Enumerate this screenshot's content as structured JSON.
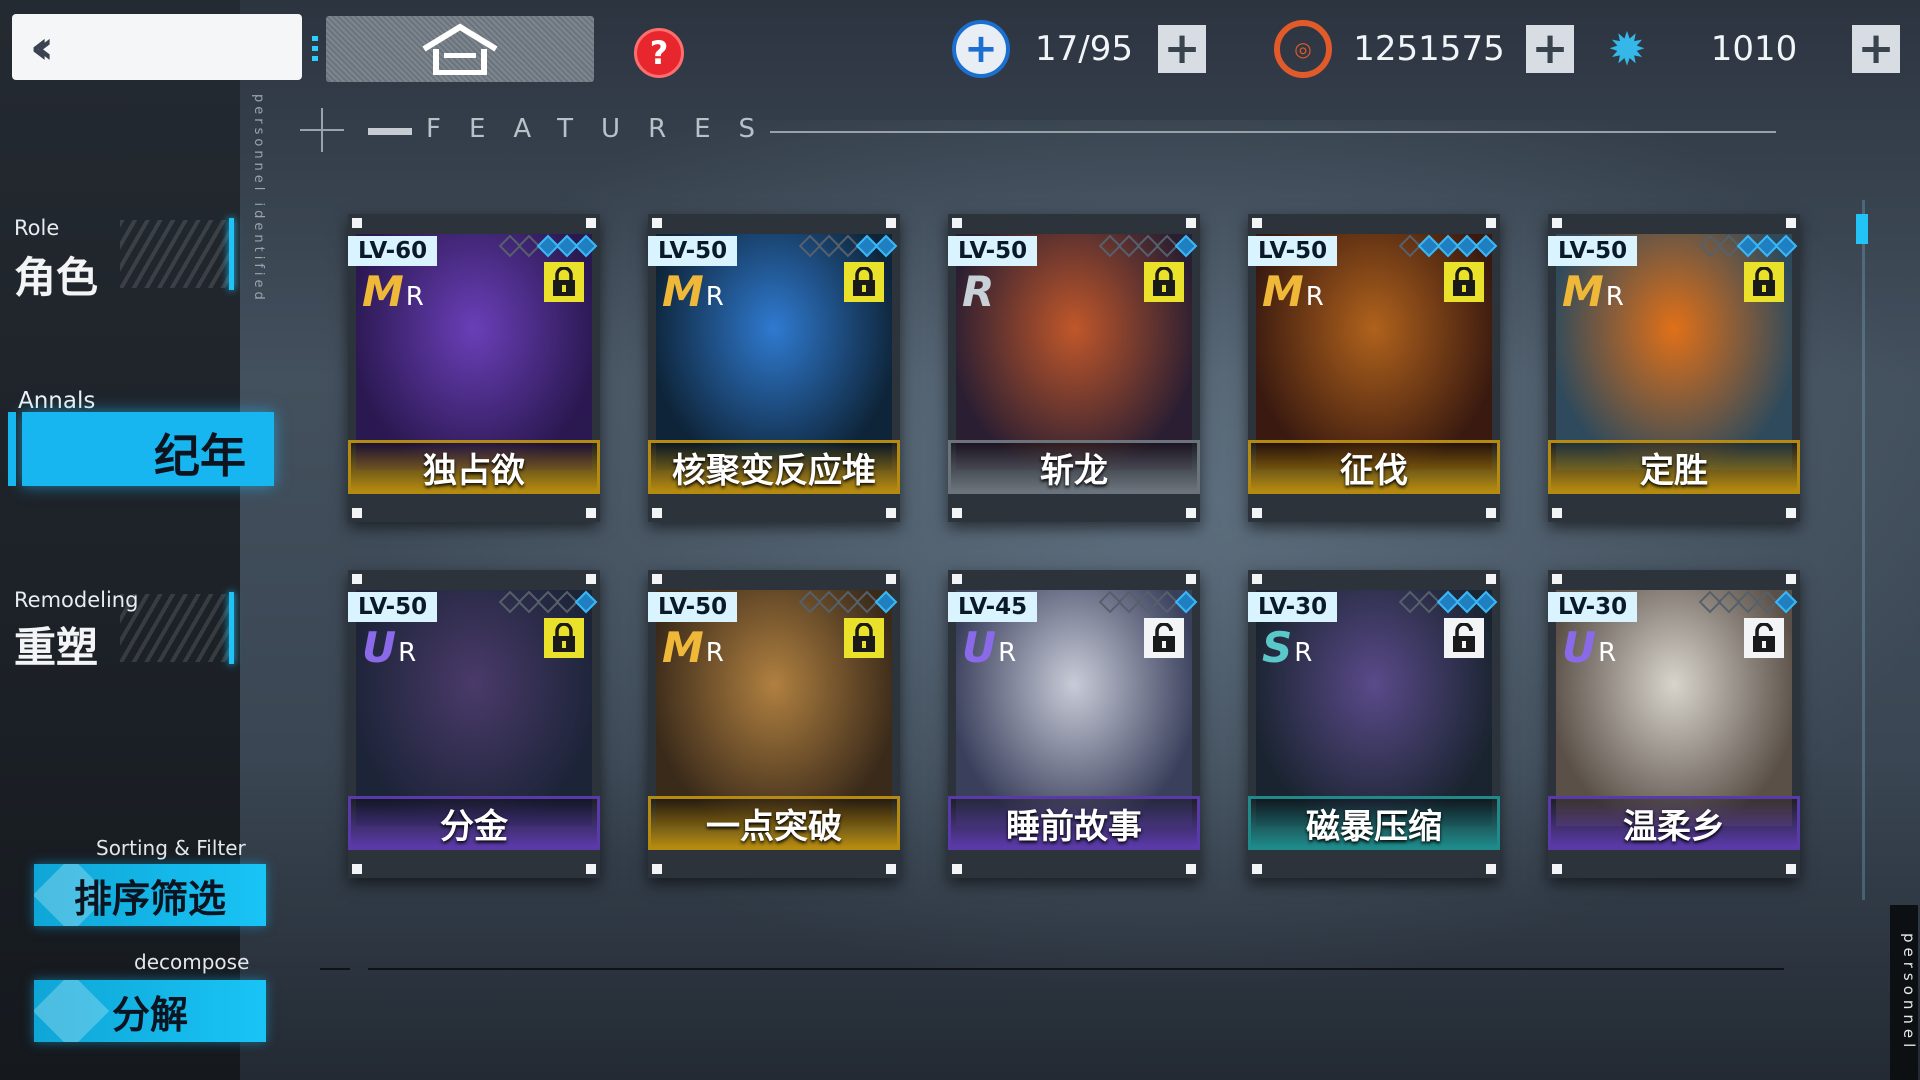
{
  "nav": {
    "back_icon": "double-chevron-left-icon",
    "home_icon": "home-icon",
    "help_icon": "question-icon",
    "vertical_caption": "personnel identified",
    "items": [
      {
        "en": "Role",
        "cn": "角色"
      },
      {
        "en": "Annals",
        "cn": "纪年"
      },
      {
        "en": "Remodeling",
        "cn": "重塑"
      }
    ],
    "sort_en": "Sorting & Filter",
    "sort_cn": "排序筛选",
    "decompose_en": "decompose",
    "decompose_cn": "分解"
  },
  "resources": [
    {
      "icon": "stamina-plus-icon",
      "value": "17/95",
      "color": "#1b6fd0"
    },
    {
      "icon": "gear-coin-icon",
      "value": "1251575",
      "color": "#e05a2a"
    },
    {
      "icon": "crystal-star-icon",
      "value": "1010",
      "color": "#35b8e8"
    }
  ],
  "header": {
    "title": "FEATURES"
  },
  "right_caption": "personnel",
  "cards": [
    {
      "level": "LV-60",
      "rarity": "M",
      "rarity_sub": "R",
      "stars": 3,
      "locked": true,
      "name": "独占欲",
      "name_bg": "#b58a10",
      "art": [
        "#6a3fb8",
        "#2a1850"
      ]
    },
    {
      "level": "LV-50",
      "rarity": "M",
      "rarity_sub": "R",
      "stars": 2,
      "locked": true,
      "name": "核聚变反应堆",
      "name_bg": "#b58a10",
      "art": [
        "#2f7ad0",
        "#0e2438"
      ]
    },
    {
      "level": "LV-50",
      "rarity": "R",
      "rarity_sub": "",
      "stars": 1,
      "locked": true,
      "name": "斩龙",
      "name_bg": "#6b737c",
      "art": [
        "#c0572a",
        "#2a1e32"
      ]
    },
    {
      "level": "LV-50",
      "rarity": "M",
      "rarity_sub": "R",
      "stars": 4,
      "locked": true,
      "name": "征伐",
      "name_bg": "#b58a10",
      "art": [
        "#b0621c",
        "#3a1a10"
      ]
    },
    {
      "level": "LV-50",
      "rarity": "M",
      "rarity_sub": "R",
      "stars": 3,
      "locked": true,
      "name": "定胜",
      "name_bg": "#b58a10",
      "art": [
        "#e07018",
        "#2e4a5c"
      ]
    },
    {
      "level": "LV-50",
      "rarity": "U",
      "rarity_sub": "R",
      "stars": 1,
      "locked": true,
      "name": "分金",
      "name_bg": "#5a3aa8",
      "art": [
        "#4a3a6a",
        "#1c2438"
      ]
    },
    {
      "level": "LV-50",
      "rarity": "M",
      "rarity_sub": "R",
      "stars": 1,
      "locked": true,
      "name": "一点突破",
      "name_bg": "#b58a10",
      "art": [
        "#b08040",
        "#3a2a1a"
      ]
    },
    {
      "level": "LV-45",
      "rarity": "U",
      "rarity_sub": "R",
      "stars": 1,
      "locked": false,
      "name": "睡前故事",
      "name_bg": "#5a3aa8",
      "art": [
        "#c8ccd8",
        "#3a3f5c"
      ]
    },
    {
      "level": "LV-30",
      "rarity": "S",
      "rarity_sub": "R",
      "stars": 3,
      "locked": false,
      "name": "磁暴压缩",
      "name_bg": "#1e8a8a",
      "art": [
        "#5a4a8a",
        "#1a2430"
      ]
    },
    {
      "level": "LV-30",
      "rarity": "U",
      "rarity_sub": "R",
      "stars": 1,
      "locked": false,
      "name": "温柔乡",
      "name_bg": "#5a3aa8",
      "art": [
        "#d8d4cc",
        "#5a5048"
      ]
    }
  ]
}
